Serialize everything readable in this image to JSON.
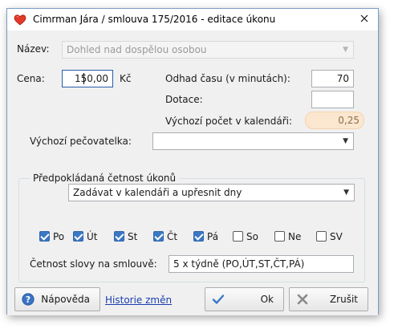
{
  "window": {
    "title": "Cimrman Jára / smlouva 175/2016 - editace úkonu",
    "title_icon": "heart-icon",
    "close_icon": "close-icon"
  },
  "form": {
    "nazev_label": "Název:",
    "nazev_value": "Dohled nad dospělou osobou",
    "cena_label": "Cena:",
    "cena_value": "150,00",
    "cena_unit": "Kč",
    "odhad_label": "Odhad času (v minutách):",
    "odhad_value": "70",
    "dotace_label": "Dotace:",
    "dotace_value": "",
    "vychozi_pocet_label": "Výchozí počet v kalendáři:",
    "vychozi_pocet_value": "0,25",
    "pecovatelka_label": "Výchozí pečovatelka:",
    "pecovatelka_value": ""
  },
  "frequency": {
    "group_title": "Předpokládaná četnost úkonů",
    "mode_value": "Zadávat v kalendáři a upřesnit dny",
    "days": [
      {
        "label": "Po",
        "checked": true
      },
      {
        "label": "Út",
        "checked": true
      },
      {
        "label": "St",
        "checked": true
      },
      {
        "label": "Čt",
        "checked": true
      },
      {
        "label": "Pá",
        "checked": true
      },
      {
        "label": "So",
        "checked": false
      },
      {
        "label": "Ne",
        "checked": false
      },
      {
        "label": "SV",
        "checked": false
      }
    ],
    "slovy_label": "Četnost slovy na smlouvě:",
    "slovy_value": "5 x týdně (PO,ÚT,ST,ČT,PÁ)"
  },
  "buttons": {
    "help_label": "Nápověda",
    "help_icon": "help-icon",
    "history_link": "Historie změn",
    "ok_label": "Ok",
    "ok_icon": "checkmark-icon",
    "cancel_label": "Zrušit",
    "cancel_icon": "cross-icon"
  },
  "colors": {
    "accent": "#3b78c4",
    "highlight": "#fbe7cf",
    "link": "#1a3fb0"
  }
}
